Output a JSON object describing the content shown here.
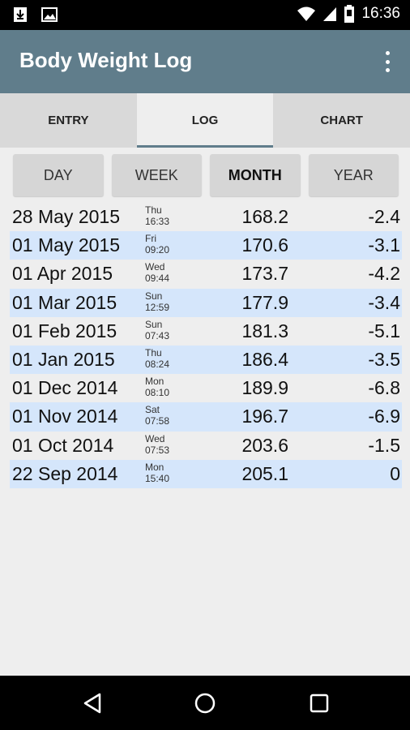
{
  "status_bar": {
    "time": "16:36",
    "icons": [
      "download-icon",
      "image-icon",
      "wifi-icon",
      "signal-icon",
      "battery-icon"
    ]
  },
  "app_bar": {
    "title": "Body Weight Log",
    "overflow_icon": "more-vert-icon",
    "color": "#607d8b"
  },
  "tabs": [
    {
      "label": "ENTRY",
      "active": false
    },
    {
      "label": "LOG",
      "active": true
    },
    {
      "label": "CHART",
      "active": false
    }
  ],
  "periods": [
    {
      "label": "DAY",
      "selected": false
    },
    {
      "label": "WEEK",
      "selected": false
    },
    {
      "label": "MONTH",
      "selected": true
    },
    {
      "label": "YEAR",
      "selected": false
    }
  ],
  "log": [
    {
      "date": "28 May 2015",
      "day": "Thu",
      "time": "16:33",
      "weight": "168.2",
      "change": "-2.4"
    },
    {
      "date": "01 May 2015",
      "day": "Fri",
      "time": "09:20",
      "weight": "170.6",
      "change": "-3.1"
    },
    {
      "date": "01 Apr 2015",
      "day": "Wed",
      "time": "09:44",
      "weight": "173.7",
      "change": "-4.2"
    },
    {
      "date": "01 Mar 2015",
      "day": "Sun",
      "time": "12:59",
      "weight": "177.9",
      "change": "-3.4"
    },
    {
      "date": "01 Feb 2015",
      "day": "Sun",
      "time": "07:43",
      "weight": "181.3",
      "change": "-5.1"
    },
    {
      "date": "01 Jan 2015",
      "day": "Thu",
      "time": "08:24",
      "weight": "186.4",
      "change": "-3.5"
    },
    {
      "date": "01 Dec 2014",
      "day": "Mon",
      "time": "08:10",
      "weight": "189.9",
      "change": "-6.8"
    },
    {
      "date": "01 Nov 2014",
      "day": "Sat",
      "time": "07:58",
      "weight": "196.7",
      "change": "-6.9"
    },
    {
      "date": "01 Oct 2014",
      "day": "Wed",
      "time": "07:53",
      "weight": "203.6",
      "change": "-1.5"
    },
    {
      "date": "22 Sep 2014",
      "day": "Mon",
      "time": "15:40",
      "weight": "205.1",
      "change": "0"
    }
  ],
  "nav_bar": {
    "buttons": [
      "back-icon",
      "home-icon",
      "recents-icon"
    ]
  },
  "colors": {
    "row_highlight": "#d5e6fb",
    "background": "#eeeeee",
    "tab_bar": "#d9d9d9"
  }
}
